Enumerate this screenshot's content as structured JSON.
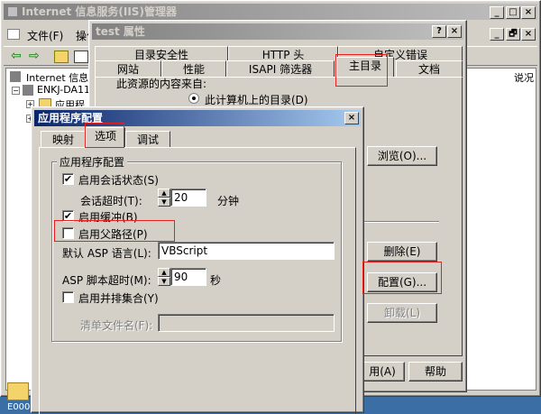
{
  "mmc": {
    "title": "Internet 信息服务(IIS)管理器",
    "menu": [
      "文件(F)",
      "操作"
    ],
    "tree": {
      "root": "Internet 信息",
      "server": "ENKJ-DA11",
      "item": "应用程"
    },
    "col_header": "说况",
    "controls": {
      "min": "_",
      "max": "□",
      "close": "×"
    }
  },
  "inner_controls": {
    "min": "_",
    "restore": "🗗",
    "close": "×"
  },
  "properties": {
    "title": "test 属性",
    "help": "?",
    "close": "×",
    "tabs_back": [
      "目录安全性",
      "HTTP 头",
      "自定义错误"
    ],
    "tabs_front": [
      "网站",
      "性能",
      "ISAPI 筛选器",
      "主目录",
      "文档"
    ],
    "selected_tab": "主目录",
    "content_source_label": "此资源的内容来自:",
    "content_source_option": "此计算机上的目录(D)",
    "browse_button": "浏览(O)...",
    "remove_button": "删除(E)",
    "config_button": "配置(G)...",
    "unload_button": "卸载(L)",
    "apply_button": "用(A)",
    "help_button": "帮助"
  },
  "app_config": {
    "title": "应用程序配置",
    "close": "×",
    "tabs": [
      "映射",
      "选项",
      "调试"
    ],
    "selected_tab": "选项",
    "group_label": "应用程序配置",
    "enable_session": {
      "label": "启用会话状态(S)",
      "checked": true,
      "check_glyph": "✔"
    },
    "session_timeout_label": "会话超时(T):",
    "session_timeout_value": "20",
    "session_timeout_unit": "分钟",
    "enable_buffer": {
      "label": "启用缓冲(B)",
      "checked": true,
      "check_glyph": "✔"
    },
    "enable_parent_paths": {
      "label": "启用父路径(P)",
      "checked": false
    },
    "default_language_label": "默认 ASP 语言(L):",
    "default_language_value": "VBScript",
    "script_timeout_label": "ASP 脚本超时(M):",
    "script_timeout_value": "90",
    "script_timeout_unit": "秒",
    "enable_side_by_side": {
      "label": "启用并排集合(Y)",
      "checked": false
    },
    "manifest_label": "清单文件名(F):",
    "manifest_value": "",
    "spin_up": "▲",
    "spin_down": "▼"
  },
  "desktop": {
    "icon_label": "E000"
  },
  "colors": {
    "highlight_box": "#e8201e",
    "title_active": "#0a246a",
    "face": "#d4d0c8"
  }
}
